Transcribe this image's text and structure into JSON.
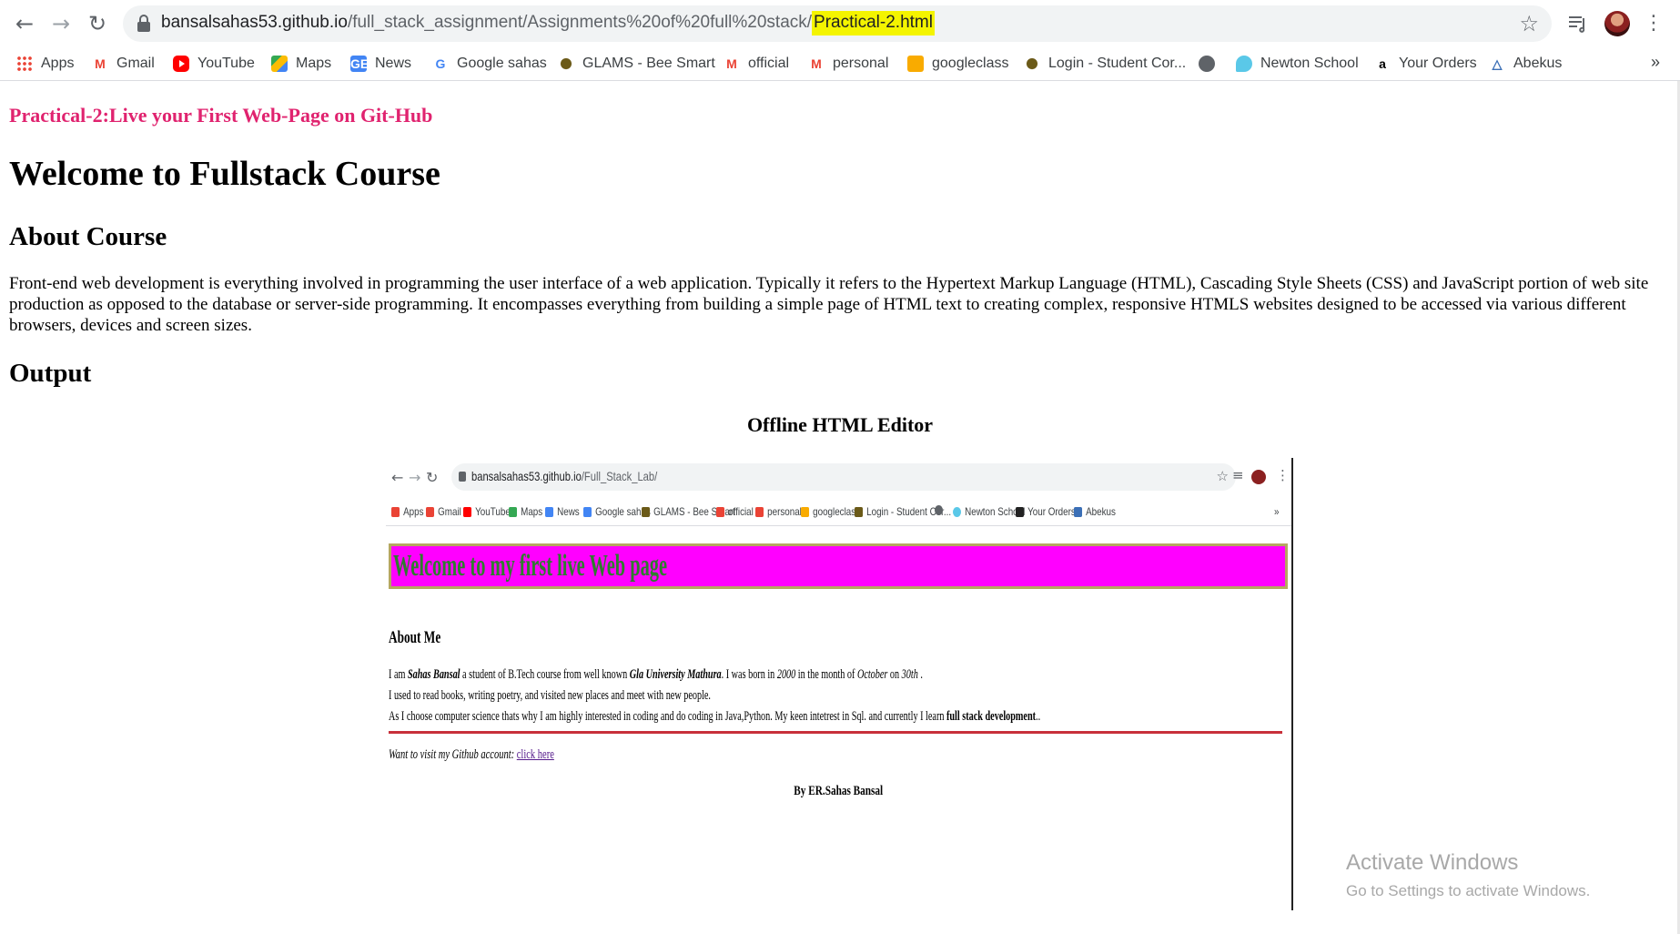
{
  "browser": {
    "url_prefix": "bansalsahas53.github.io",
    "url_path": "/full_stack_assignment/Assignments%20of%20full%20stack/",
    "url_highlight": "Practical-2.html",
    "bookmarks": [
      {
        "label": "Apps",
        "icon": "apps-grid-icon"
      },
      {
        "label": "Gmail",
        "icon": "gmail-icon"
      },
      {
        "label": "YouTube",
        "icon": "youtube-icon"
      },
      {
        "label": "Maps",
        "icon": "maps-icon"
      },
      {
        "label": "News",
        "icon": "news-icon"
      },
      {
        "label": "Google sahas",
        "icon": "google-icon"
      },
      {
        "label": "GLAMS - Bee Smart",
        "icon": "bee-icon"
      },
      {
        "label": "official",
        "icon": "gmail-icon"
      },
      {
        "label": "personal",
        "icon": "gmail-icon"
      },
      {
        "label": "googleclass",
        "icon": "classroom-icon"
      },
      {
        "label": "Login - Student Cor...",
        "icon": "bee-icon"
      },
      {
        "label": "",
        "icon": "globe-icon"
      },
      {
        "label": "Newton School",
        "icon": "newton-icon"
      },
      {
        "label": "Your Orders",
        "icon": "amazon-icon"
      },
      {
        "label": "Abekus",
        "icon": "abekus-icon"
      }
    ],
    "more_label": "»"
  },
  "page": {
    "practical_title": "Practical-2:Live your First Web-Page on Git-Hub",
    "heading": "Welcome to Fullstack Course",
    "about_heading": "About Course",
    "about_text": "Front-end web development is everything involved in programming the user interface of a web application. Typically it refers to the Hypertext Markup Language (HTML), Cascading Style Sheets (CSS) and JavaScript portion of web site production as opposed to the database or server-side programming. It encompasses everything from building a simple page of HTML text to creating complex, responsive HTMLS websites designed to be accessed via various different browsers, devices and screen sizes.",
    "output_heading": "Output",
    "caption": "Offline HTML Editor"
  },
  "screenshot": {
    "url_prefix": "bansalsahas53.github.io",
    "url_path": "/Full_Stack_Lab/",
    "bookmarks": [
      "Apps",
      "Gmail",
      "YouTube",
      "Maps",
      "News",
      "Google sahas",
      "GLAMS - Bee Smart",
      "official",
      "personal",
      "googleclass",
      "Login - Student Cor...",
      "",
      "Newton School",
      "Your Orders",
      "Abekus"
    ],
    "more_label": "»",
    "banner": "Welcome to my first live Web page",
    "about_heading": "About Me",
    "line1": {
      "t1": "I am ",
      "name": "Sahas Bansal",
      "t2": " a student of B.Tech course from well known ",
      "university": "Gla University Mathura",
      "t3": ". I was born in ",
      "year": "2000",
      "t4": " in the month of ",
      "month": "October",
      "t5": " on ",
      "day": "30th",
      "t6": " ."
    },
    "line2": "I used to read books, writing poetry, and visited new places and meet with new people.",
    "line3": {
      "text": "As I choose computer science thats why I am highly interested in coding and do coding in Java,Python. My keen intetrest in Sql. and currently I learn ",
      "bold": "full stack development",
      "end": ".."
    },
    "github_text": "Want to visit my Github account: ",
    "github_link": "click here",
    "author": "By ER.Sahas Bansal"
  },
  "watermark": {
    "title": "Activate Windows",
    "subtitle": "Go to Settings to activate Windows."
  },
  "colors": {
    "practical_title": "#e0236f",
    "banner_bg": "#ff00ff",
    "banner_text": "#2e7d2e",
    "url_highlight": "#f4f400"
  }
}
